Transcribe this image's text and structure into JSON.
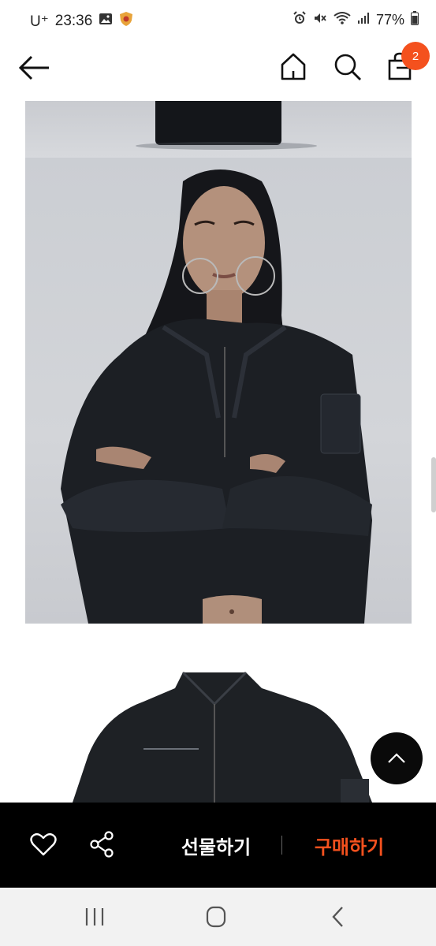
{
  "status_bar": {
    "carrier": "U⁺",
    "time": "23:36",
    "battery": "77%",
    "icons": [
      "gallery-icon",
      "shield-app-icon",
      "alarm-icon",
      "mute-icon",
      "wifi-icon",
      "signal-icon",
      "battery-icon"
    ]
  },
  "header": {
    "cart_count": "2",
    "icons": [
      "back-arrow-icon",
      "home-icon",
      "search-icon",
      "shopping-bag-icon"
    ]
  },
  "actions": {
    "gift_label": "선물하기",
    "buy_label": "구매하기"
  },
  "colors": {
    "accent": "#f4511e",
    "action_bar_bg": "#000000"
  },
  "system_nav": {
    "icons": [
      "recents-icon",
      "home-circle-icon",
      "back-chevron-icon"
    ]
  }
}
